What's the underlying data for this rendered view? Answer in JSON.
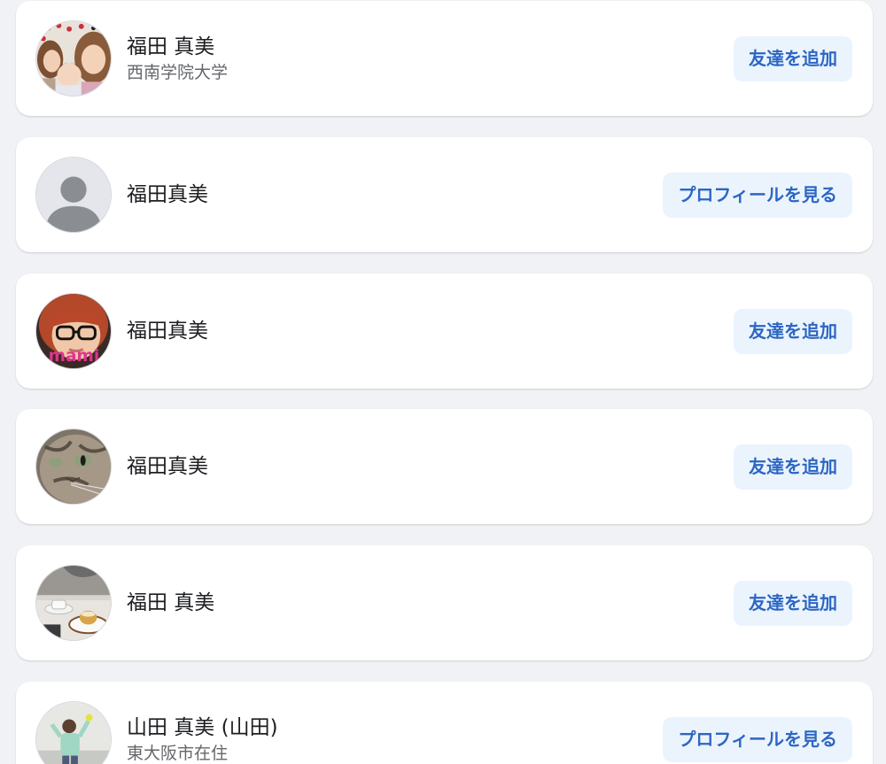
{
  "results": [
    {
      "name": "福田 真美",
      "subtitle": "西南学院大学",
      "button_label": "友達を追加",
      "avatar_icon": "photo-avatar-family-icon"
    },
    {
      "name": "福田真美",
      "subtitle": "",
      "button_label": "プロフィールを見る",
      "avatar_icon": "default-profile-silhouette-icon"
    },
    {
      "name": "福田真美",
      "subtitle": "",
      "button_label": "友達を追加",
      "avatar_icon": "photo-avatar-glasses-icon",
      "avatar_text": "mami"
    },
    {
      "name": "福田真美",
      "subtitle": "",
      "button_label": "友達を追加",
      "avatar_icon": "photo-avatar-cat-icon"
    },
    {
      "name": "福田 真美",
      "subtitle": "",
      "button_label": "友達を追加",
      "avatar_icon": "photo-avatar-cafe-icon"
    },
    {
      "name": "山田 真美 (山田)",
      "subtitle": "東大阪市在住",
      "button_label": "プロフィールを見る",
      "avatar_icon": "photo-avatar-child-icon"
    }
  ],
  "colors": {
    "background": "#f0f2f5",
    "card": "#ffffff",
    "button_bg": "#ebf4fd",
    "button_text": "#2d66c4",
    "name_text": "#1c1e21",
    "subtitle_text": "#65676b"
  }
}
